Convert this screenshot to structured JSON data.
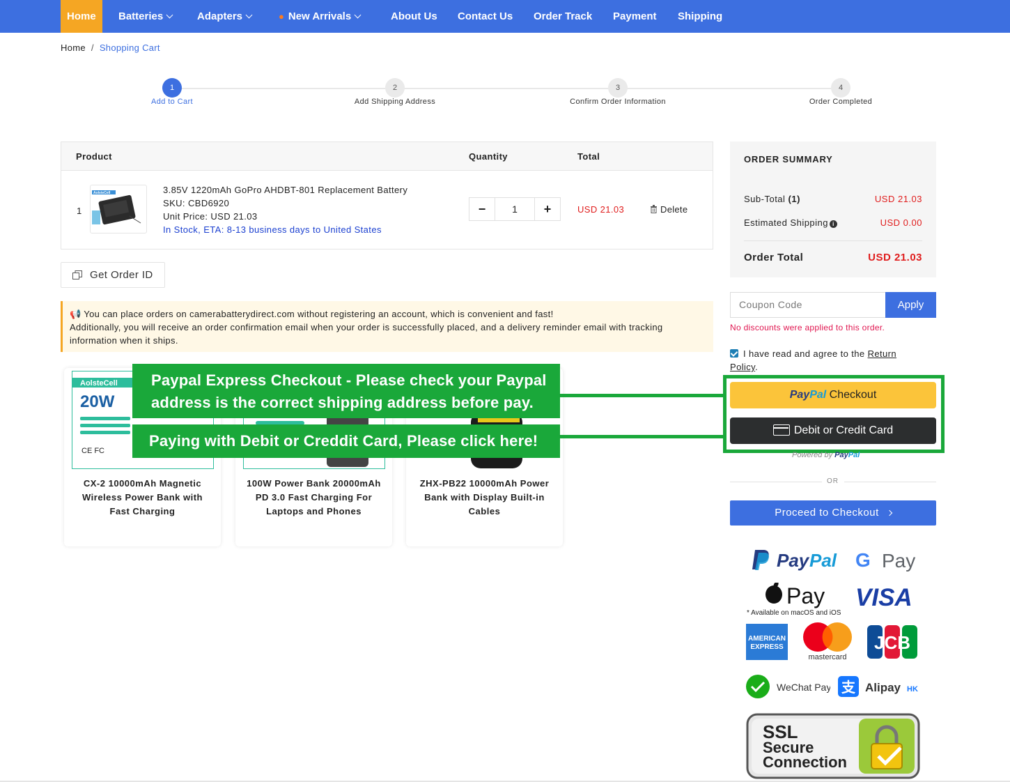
{
  "nav": {
    "home": "Home",
    "batteries": "Batteries",
    "adapters": "Adapters",
    "new_arrivals": "New Arrivals",
    "about": "About Us",
    "contact": "Contact Us",
    "order_track": "Order Track",
    "payment": "Payment",
    "shipping": "Shipping"
  },
  "breadcrumb": {
    "home": "Home",
    "sep": "/",
    "current": "Shopping Cart"
  },
  "steps": [
    {
      "num": "1",
      "label": "Add to Cart"
    },
    {
      "num": "2",
      "label": "Add Shipping Address"
    },
    {
      "num": "3",
      "label": "Confirm Order Information"
    },
    {
      "num": "4",
      "label": "Order Completed"
    }
  ],
  "cart": {
    "headers": {
      "product": "Product",
      "quantity": "Quantity",
      "total": "Total"
    },
    "item": {
      "index": "1",
      "name": "3.85V 1220mAh GoPro AHDBT-801 Replacement Battery",
      "sku": "SKU: CBD6920",
      "unit_price": "Unit Price: USD 21.03",
      "stock": "In Stock, ETA: 8-13 business days to United States",
      "quantity": "1",
      "total": "USD 21.03",
      "delete": "Delete",
      "thumb_brand": "AolsteCell"
    }
  },
  "get_order_id": "Get Order ID",
  "notice": {
    "line1": "You can place orders on camerabatterydirect.com without registering an account, which is convenient and fast!",
    "line2": "Additionally, you will receive an order confirmation email when your order is successfully placed, and a delivery reminder email with tracking information when it ships."
  },
  "products": [
    {
      "title": "CX-2 10000mAh Magnetic Wireless Power Bank with Fast Charging",
      "img_brand": "AolsteCell",
      "img_watt": "20W"
    },
    {
      "title": "100W Power Bank 20000mAh PD 3.0 Fast Charging For Laptops and Phones"
    },
    {
      "title": "ZHX-PB22 10000mAh Power Bank with Display Built-in Cables"
    }
  ],
  "annotations": {
    "paypal_line1": "Paypal Express Checkout - Please check your Paypal",
    "paypal_line2": "address is the correct shipping address before pay.",
    "card": "Paying with Debit or Creddit Card, Please click here!"
  },
  "summary": {
    "title": "ORDER SUMMARY",
    "subtotal_label": "Sub-Total",
    "subtotal_count": "(1)",
    "subtotal_value": "USD 21.03",
    "shipping_label": "Estimated Shipping",
    "shipping_value": "USD 0.00",
    "total_label": "Order Total",
    "total_value": "USD 21.03"
  },
  "coupon": {
    "placeholder": "Coupon Code",
    "apply": "Apply",
    "message": "No discounts were applied to this order."
  },
  "agree": {
    "text": "I have read and agree to the",
    "link": "Return Policy",
    "end": "."
  },
  "paypal_button": {
    "brand1": "Pay",
    "brand2": "Pal",
    "label": "Checkout"
  },
  "card_button": "Debit or Credit Card",
  "powered": {
    "text": "Powered by",
    "brand1": "Pay",
    "brand2": "Pal"
  },
  "or": "OR",
  "proceed": "Proceed to Checkout",
  "payment_logos": {
    "paypal1": "Pay",
    "paypal2": "Pal",
    "gpay": "Pay",
    "applepay": "Pay",
    "apple_note": "* Available on macOS and iOS",
    "visa": "VISA",
    "amex1": "AMERICAN",
    "amex2": "EXPRESS",
    "mastercard": "mastercard",
    "jcb": "JCB",
    "wechat": "WeChat Pay",
    "alipay": "Alipay",
    "alipay_hk": "HK"
  },
  "ssl": {
    "line1": "SSL",
    "line2": "Secure",
    "line3": "Connection"
  },
  "colors": {
    "nav_bg": "#3d6fe0",
    "home_tab": "#f5a623",
    "price_red": "#e01d1d",
    "annotation_green": "#1aa83a",
    "paypal_yellow": "#fbc43a"
  }
}
